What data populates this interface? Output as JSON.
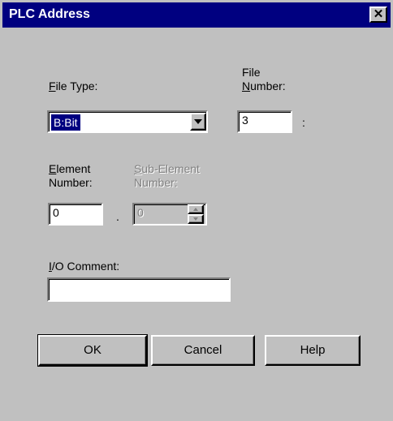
{
  "window": {
    "title": "PLC Address",
    "close_glyph": "✕"
  },
  "file_type": {
    "label_mnemonic": "F",
    "label_rest": "ile Type:",
    "value": "B:Bit"
  },
  "file_number": {
    "label_line1": "File",
    "label_mnemonic": "N",
    "label_rest": "umber:",
    "value": "3",
    "separator": ":"
  },
  "element_number": {
    "label_mnemonic": "E",
    "label_rest": "lement\nNumber:",
    "value": "0",
    "separator": "."
  },
  "sub_element_number": {
    "label_mnemonic": "S",
    "label_rest": "ub-Element\nNumber:",
    "value": "0"
  },
  "io_comment": {
    "label_mnemonic": "I",
    "label_rest": "/O Comment:",
    "value": ""
  },
  "buttons": {
    "ok": "OK",
    "cancel": "Cancel",
    "help": "Help"
  },
  "icons": {
    "close": "close-icon",
    "dropdown": "chevron-down-icon",
    "spin_up": "spin-up-icon",
    "spin_down": "spin-down-icon"
  }
}
